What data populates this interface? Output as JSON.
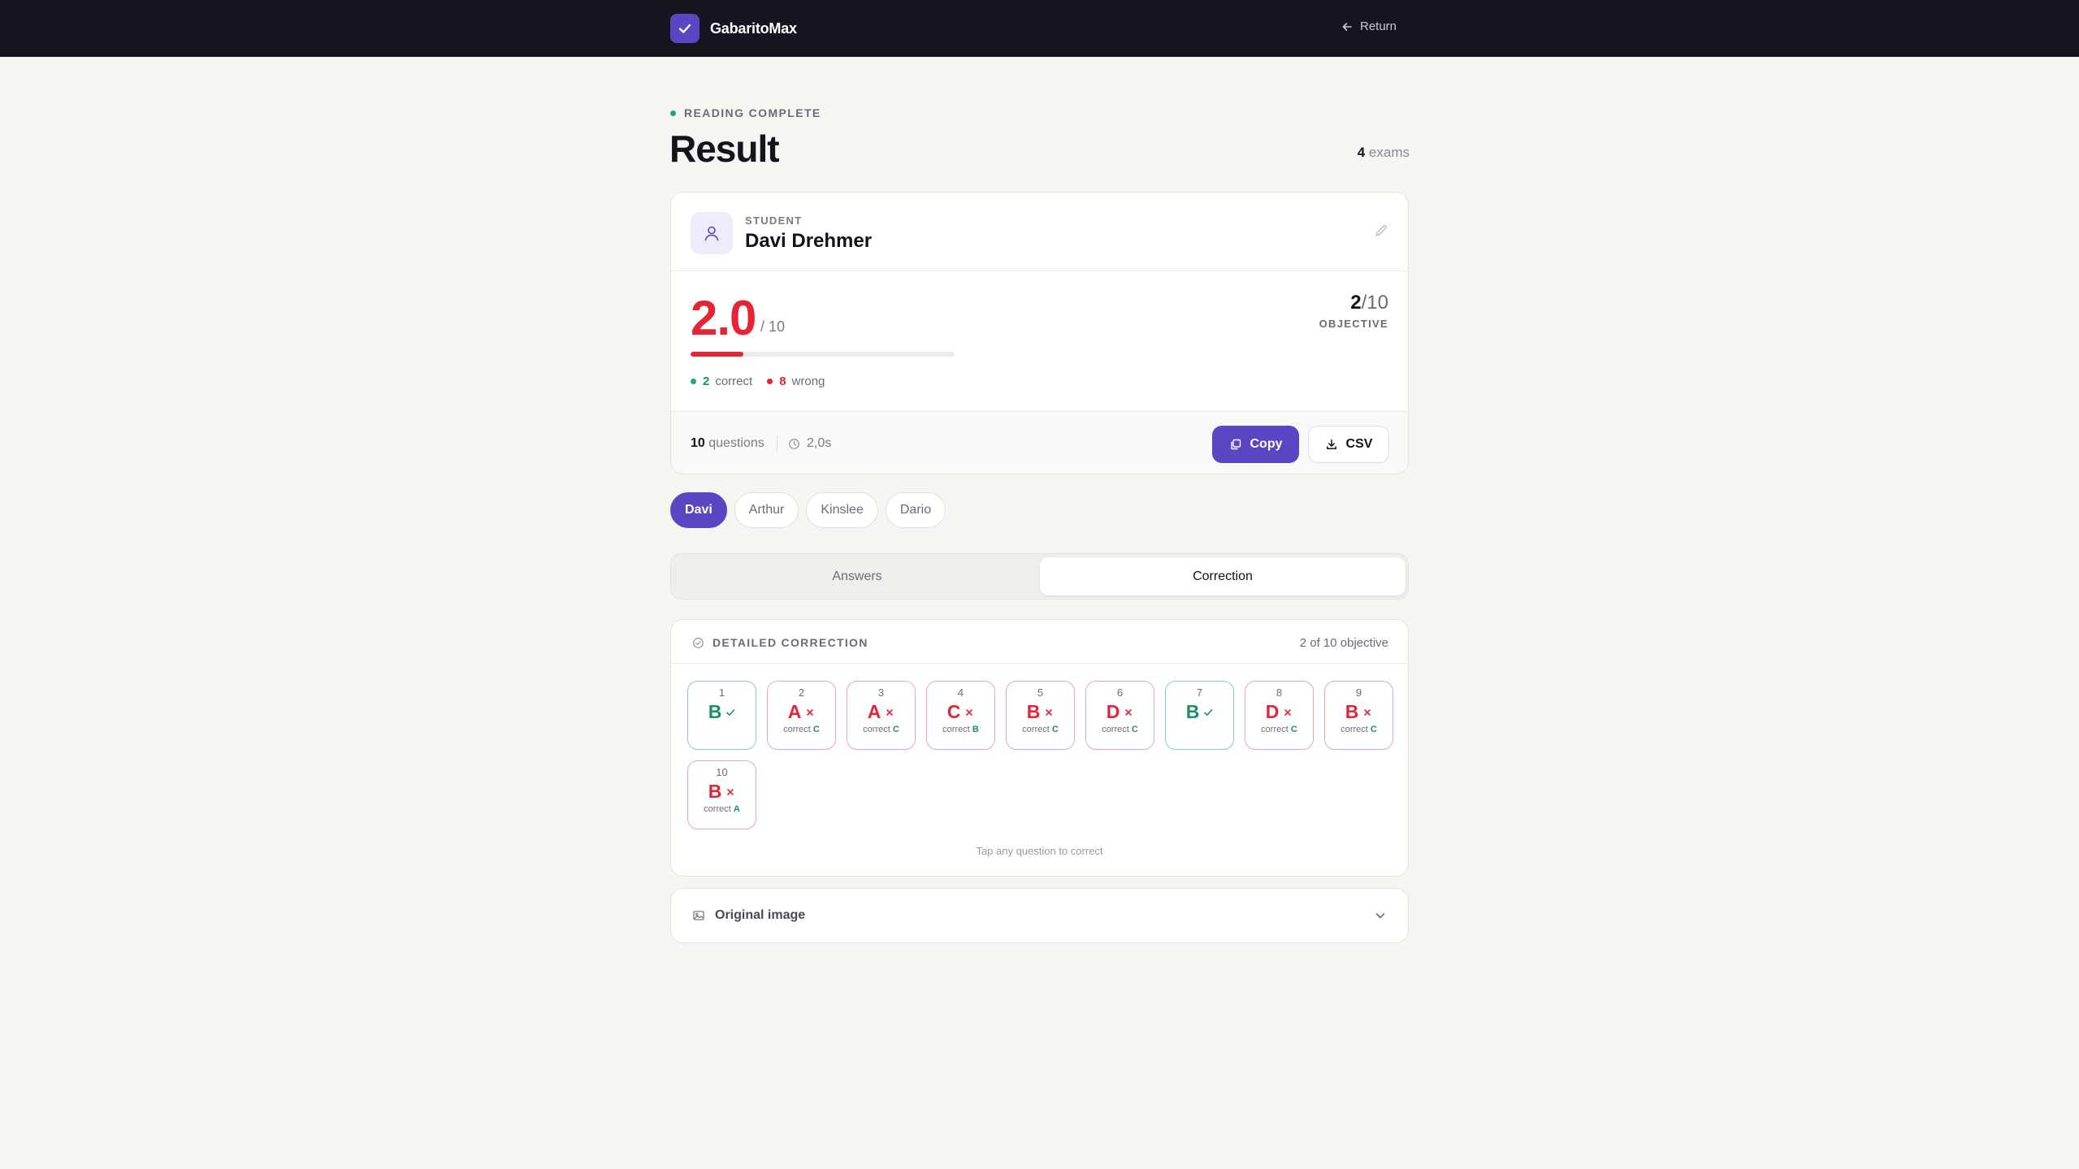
{
  "app": {
    "name": "GabaritoMax",
    "return_label": "Return",
    "icons": {
      "logo": "check-icon",
      "return": "arrow-left-icon"
    }
  },
  "page": {
    "status": "READING COMPLETE",
    "title": "Result",
    "exams_count": "4",
    "exams_label": "exams"
  },
  "student": {
    "label": "STUDENT",
    "name": "Davi Drehmer",
    "score": "2.0",
    "score_max": "/ 10",
    "score_fraction": 0.2,
    "correct_count": "2",
    "correct_label": "correct",
    "wrong_count": "8",
    "wrong_label": "wrong",
    "objective_score": "2",
    "objective_total": "/10",
    "objective_label": "OBJECTIVE",
    "questions_count": "10",
    "questions_label": "questions",
    "elapsed": "2,0s",
    "copy_label": "Copy",
    "csv_label": "CSV"
  },
  "students": [
    {
      "name": "Davi",
      "active": true
    },
    {
      "name": "Arthur",
      "active": false
    },
    {
      "name": "Kinslee",
      "active": false
    },
    {
      "name": "Dario",
      "active": false
    }
  ],
  "tabs": [
    {
      "label": "Answers",
      "active": false
    },
    {
      "label": "Correction",
      "active": true
    }
  ],
  "correction": {
    "title": "DETAILED CORRECTION",
    "summary": "2 of 10 objective",
    "correct_prefix": "correct",
    "hint": "Tap any question to correct",
    "questions": [
      {
        "num": "1",
        "answer": "B",
        "correct": true,
        "key": ""
      },
      {
        "num": "2",
        "answer": "A",
        "correct": false,
        "key": "C"
      },
      {
        "num": "3",
        "answer": "A",
        "correct": false,
        "key": "C"
      },
      {
        "num": "4",
        "answer": "C",
        "correct": false,
        "key": "B"
      },
      {
        "num": "5",
        "answer": "B",
        "correct": false,
        "key": "C"
      },
      {
        "num": "6",
        "answer": "D",
        "correct": false,
        "key": "C"
      },
      {
        "num": "7",
        "answer": "B",
        "correct": true,
        "key": ""
      },
      {
        "num": "8",
        "answer": "D",
        "correct": false,
        "key": "C"
      },
      {
        "num": "9",
        "answer": "B",
        "correct": false,
        "key": "C"
      },
      {
        "num": "10",
        "answer": "B",
        "correct": false,
        "key": "A"
      }
    ]
  },
  "original_image": {
    "label": "Original image"
  },
  "colors": {
    "accent": "#5b45c2",
    "correct": "#16935f",
    "wrong": "#e52535",
    "topbar": "#15151f"
  }
}
